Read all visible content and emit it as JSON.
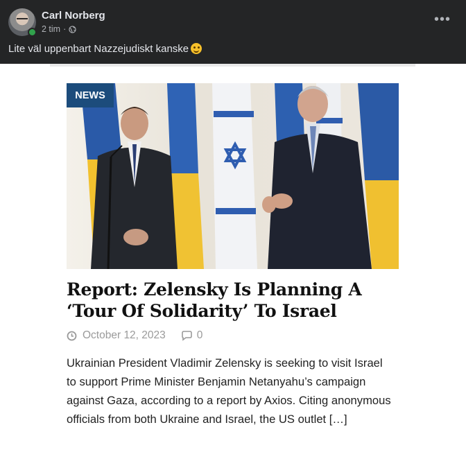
{
  "post": {
    "author": "Carl Norberg",
    "time": "2 tim",
    "separator": "·",
    "caption": "Lite väl uppenbart Nazzejudiskt kanske",
    "more_label": "•••"
  },
  "article": {
    "badge": "NEWS",
    "headline": "Report: Zelensky Is Planning A ‘Tour Of Solidarity’ To Israel",
    "date": "October 12, 2023",
    "comment_count": "0",
    "excerpt": "Ukrainian President Vladimir Zelensky is seeking to visit Israel to support Prime Minister Benjamin Netanyahu’s campaign against Gaza, according to a report by Axios. Citing anonymous officials from both Ukraine and Israel, the US outlet […]"
  },
  "icons": {
    "globe": "globe-icon",
    "clock": "clock-icon",
    "comment": "comment-icon",
    "more": "more-options-icon"
  },
  "colors": {
    "header_bg": "#242526",
    "badge_bg": "#1c4c7c",
    "online": "#31a24c"
  }
}
